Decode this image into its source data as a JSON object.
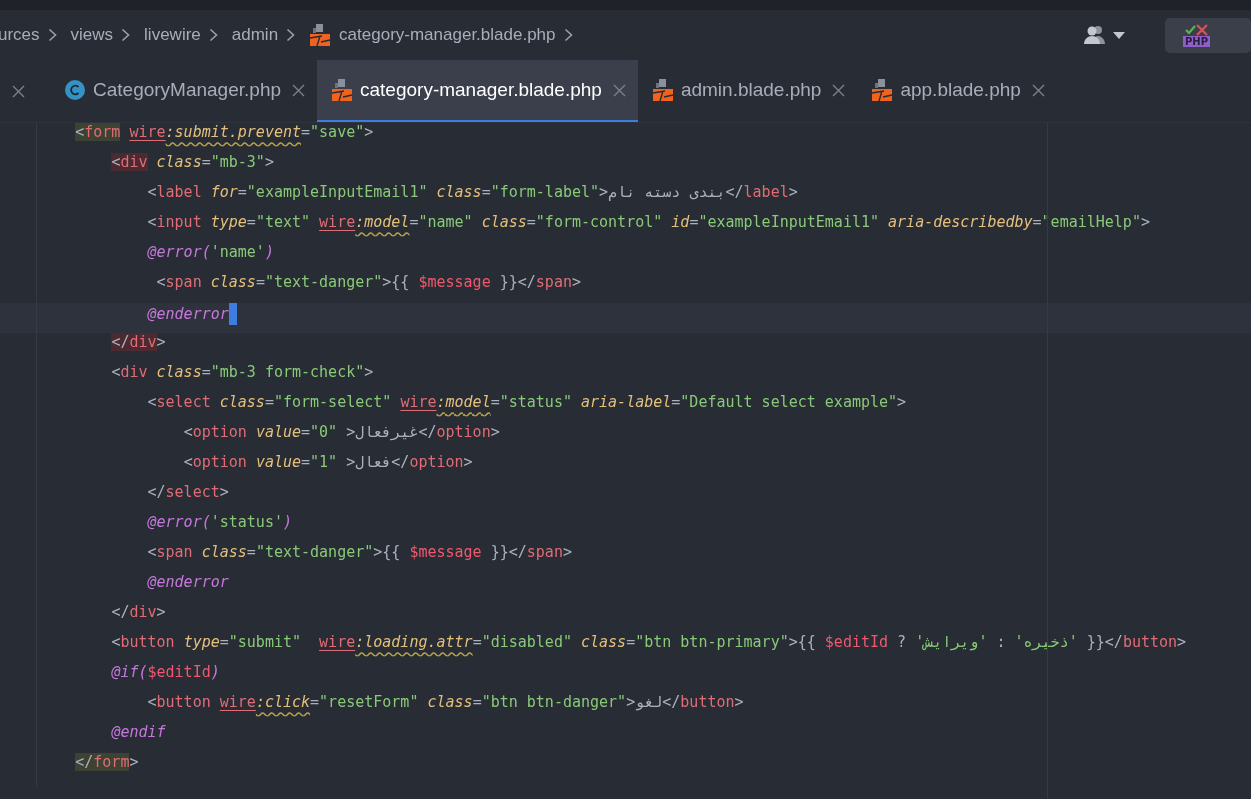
{
  "breadcrumbs": [
    {
      "label": "urces",
      "kind": "folder"
    },
    {
      "label": "views",
      "kind": "folder"
    },
    {
      "label": "livewire",
      "kind": "folder"
    },
    {
      "label": "admin",
      "kind": "folder"
    },
    {
      "label": "category-manager.blade.php",
      "kind": "blade"
    }
  ],
  "toolbar": {
    "php_badge": "PHP"
  },
  "tabs": [
    {
      "label": "CategoryManager.php",
      "kind": "class",
      "selected": false
    },
    {
      "label": "category-manager.blade.php",
      "kind": "blade",
      "selected": true
    },
    {
      "label": "admin.blade.php",
      "kind": "blade",
      "selected": false
    },
    {
      "label": "app.blade.php",
      "kind": "blade",
      "selected": false
    }
  ],
  "editor": {
    "lines": [
      {
        "text": "        <form wire:submit.prevent=\"save\">",
        "current": false,
        "kind": "matched"
      },
      {
        "text": "            <div class=\"mb-3\">",
        "current": false,
        "kind": "unmatched"
      },
      {
        "text": "                <label for=\"exampleInputEmail1\" class=\"form-label\">نام دسته بندی</label>",
        "current": false,
        "kind": "plain"
      },
      {
        "text": "                <input type=\"text\" wire:model=\"name\" class=\"form-control\" id=\"exampleInputEmail1\" aria-describedby=\"emailHelp\">",
        "current": false,
        "kind": "plain"
      },
      {
        "text": "                @error('name')",
        "current": false,
        "kind": "plain"
      },
      {
        "text": "                 <span class=\"text-danger\">{{ $message }}</span>",
        "current": false,
        "kind": "plain"
      },
      {
        "text": "                @enderror",
        "current": true,
        "kind": "plain"
      },
      {
        "text": "            </div>",
        "current": false,
        "kind": "unmatched"
      },
      {
        "text": "            <div class=\"mb-3 form-check\">",
        "current": false,
        "kind": "plain"
      },
      {
        "text": "                <select class=\"form-select\" wire:model=\"status\" aria-label=\"Default select example\">",
        "current": false,
        "kind": "plain"
      },
      {
        "text": "                    <option value=\"0\" >غیرفعال</option>",
        "current": false,
        "kind": "plain"
      },
      {
        "text": "                    <option value=\"1\" >فعال</option>",
        "current": false,
        "kind": "plain"
      },
      {
        "text": "                </select>",
        "current": false,
        "kind": "plain"
      },
      {
        "text": "                @error('status')",
        "current": false,
        "kind": "plain"
      },
      {
        "text": "                <span class=\"text-danger\">{{ $message }}</span>",
        "current": false,
        "kind": "plain"
      },
      {
        "text": "                @enderror",
        "current": false,
        "kind": "plain"
      },
      {
        "text": "            </div>",
        "current": false,
        "kind": "plain"
      },
      {
        "text": "            <button type=\"submit\"  wire:loading.attr=\"disabled\" class=\"btn btn-primary\">{{ $editId ? 'ویرایش' : 'ذخیره' }}</button>",
        "current": false,
        "kind": "plain"
      },
      {
        "text": "            @if($editId)",
        "current": false,
        "kind": "plain"
      },
      {
        "text": "                <button wire:click=\"resetForm\" class=\"btn btn-danger\">لغو</button>",
        "current": false,
        "kind": "plain"
      },
      {
        "text": "            @endif",
        "current": false,
        "kind": "plain"
      },
      {
        "text": "        </form>",
        "current": false,
        "kind": "matched"
      }
    ]
  }
}
